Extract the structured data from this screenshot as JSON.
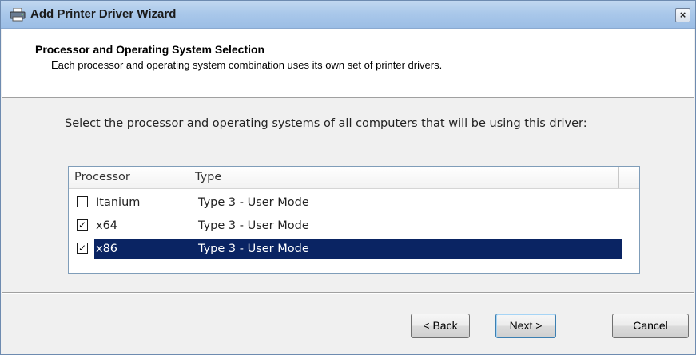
{
  "window": {
    "title": "Add Printer Driver Wizard",
    "close_glyph": "×",
    "app_icon": "printer-icon"
  },
  "header": {
    "title": "Processor and Operating System Selection",
    "subtitle": "Each processor and operating system combination uses its own set of printer drivers."
  },
  "instruction": "Select the processor and operating systems of all computers that will be using this driver:",
  "list": {
    "columns": [
      "Processor",
      "Type",
      ""
    ],
    "rows": [
      {
        "processor": "Itanium",
        "type": "Type 3 - User Mode",
        "checked": false,
        "selected": false,
        "check_glyph": ""
      },
      {
        "processor": "x64",
        "type": "Type 3 - User Mode",
        "checked": true,
        "selected": false,
        "check_glyph": "✓"
      },
      {
        "processor": "x86",
        "type": "Type 3 - User Mode",
        "checked": true,
        "selected": true,
        "check_glyph": "✓"
      }
    ]
  },
  "buttons": {
    "back": "< Back",
    "next": "Next >",
    "cancel": "Cancel"
  },
  "colors": {
    "selection": "#0a2463",
    "titlebar": "#aac8ea"
  }
}
